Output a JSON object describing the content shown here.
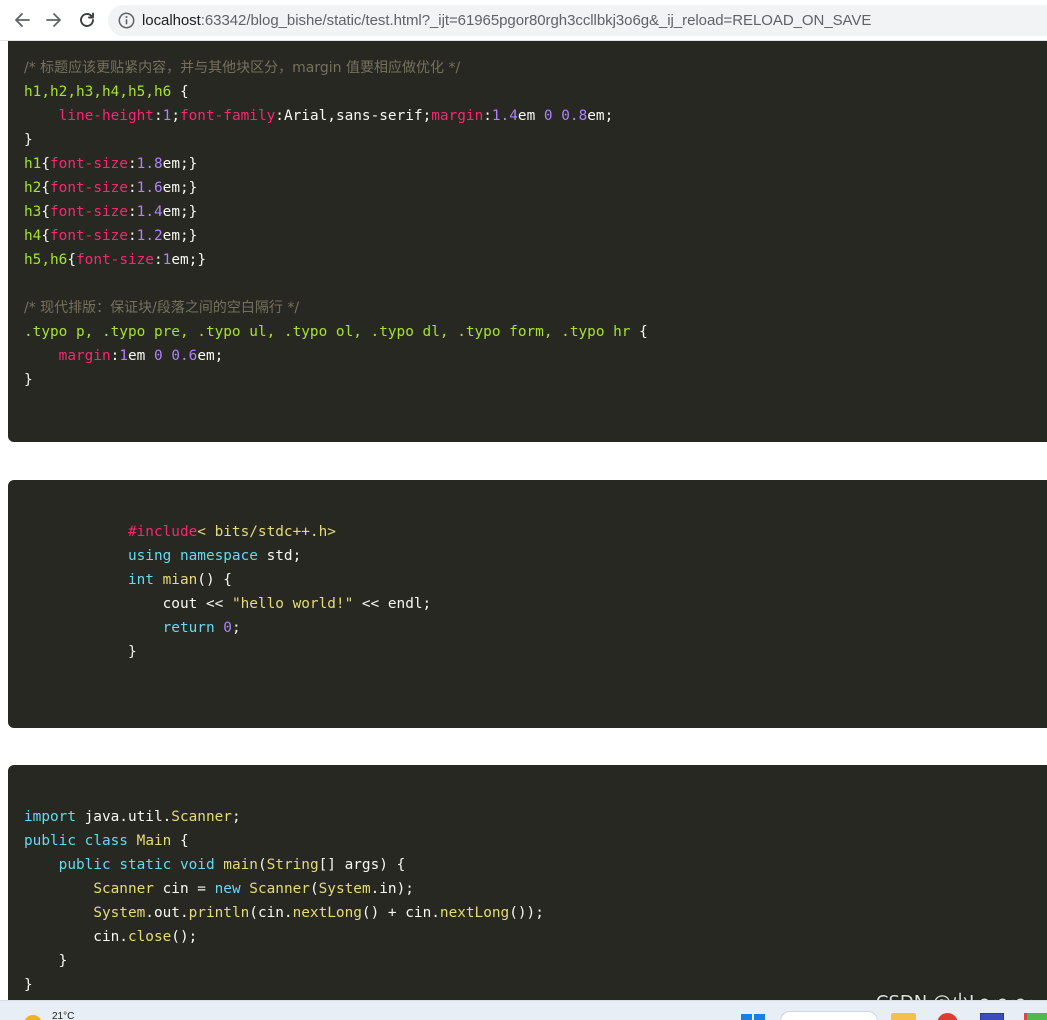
{
  "browser": {
    "url_host": "localhost",
    "url_rest": ":63342/blog_bishe/static/test.html?_ijt=61965pgor80rgh3ccllbkj3o6g&_ij_reload=RELOAD_ON_SAVE",
    "icons": [
      "back-arrow-icon",
      "forward-arrow-icon",
      "reload-icon",
      "info-icon"
    ]
  },
  "theme": {
    "background": "#272822",
    "text": "#f8f8f2",
    "comment": "#75715e",
    "tag": "#a6e22e",
    "keyword": "#f92672",
    "number": "#ae81ff",
    "builtin": "#66d9ef",
    "string": "#e6db74"
  },
  "code_blocks": [
    {
      "language": "css",
      "lines": [
        "/* 标题应该更贴紧内容，并与其他块区分，margin 值要相应做优化 */",
        "h1,h2,h3,h4,h5,h6 {",
        "    line-height:1;font-family:Arial,sans-serif;margin:1.4em 0 0.8em;",
        "}",
        "h1{font-size:1.8em;}",
        "h2{font-size:1.6em;}",
        "h3{font-size:1.4em;}",
        "h4{font-size:1.2em;}",
        "h5,h6{font-size:1em;}",
        "",
        "/* 现代排版：保证块/段落之间的空白隔行 */",
        ".typo p, .typo pre, .typo ul, .typo ol, .typo dl, .typo form, .typo hr {",
        "    margin:1em 0 0.6em;",
        "}"
      ]
    },
    {
      "language": "cpp",
      "lines": [
        "            #include< bits/stdc++.h>",
        "            using namespace std;",
        "            int mian() {",
        "                cout << \"hello world!\" << endl;",
        "                return 0;",
        "            }"
      ]
    },
    {
      "language": "java",
      "lines": [
        "import java.util.Scanner;",
        "public class Main {",
        "    public static void main(String[] args) {",
        "        Scanner cin = new Scanner(System.in);",
        "        System.out.println(cin.nextLong() + cin.nextLong());",
        "        cin.close();",
        "    }",
        "}"
      ]
    }
  ],
  "taskbar": {
    "temperature": "21°C",
    "icons": [
      "weather-icon",
      "start-icon",
      "search-bar",
      "folder-icon",
      "browser-icon",
      "app-icon"
    ]
  },
  "watermark": "CSDN @小L～～～"
}
